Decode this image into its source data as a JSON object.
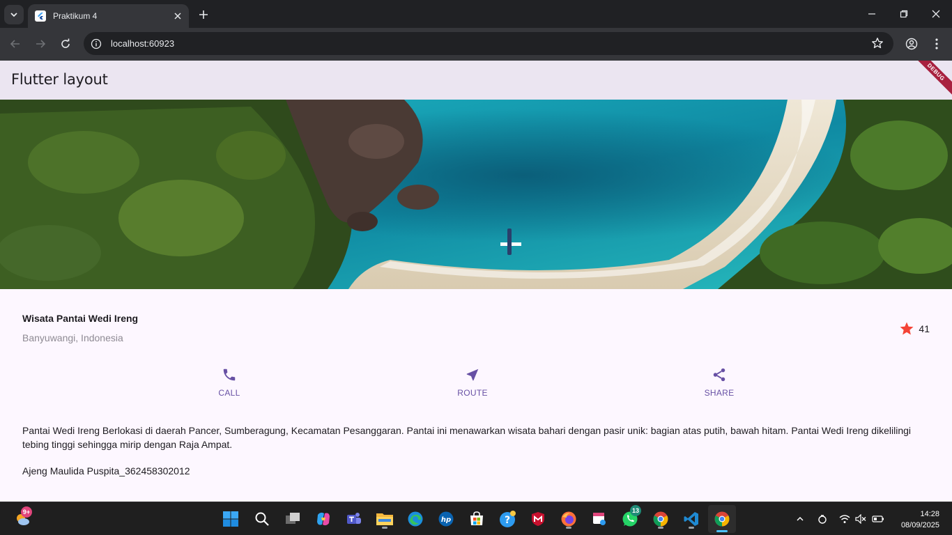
{
  "browser": {
    "tab_title": "Praktikum 4",
    "url": "localhost:60923"
  },
  "app": {
    "appbar_title": "Flutter layout",
    "debug_banner": "DEBUG",
    "place": {
      "name": "Wisata Pantai Wedi Ireng",
      "location": "Banyuwangi, Indonesia",
      "rating_count": "41"
    },
    "actions": [
      {
        "label": "CALL",
        "icon": "phone-icon"
      },
      {
        "label": "ROUTE",
        "icon": "near-me-icon"
      },
      {
        "label": "SHARE",
        "icon": "share-icon"
      }
    ],
    "description": "Pantai Wedi Ireng Berlokasi di daerah Pancer, Sumberagung, Kecamatan Pesanggaran. Pantai ini menawarkan wisata bahari dengan pasir unik: bagian atas putih, bawah hitam. Pantai Wedi Ireng dikelilingi tebing tinggi sehingga mirip dengan Raja Ampat.",
    "author": "Ajeng Maulida Puspita_362458302012"
  },
  "taskbar": {
    "weather_badge": "9+",
    "whatsapp_badge": "13",
    "time": "14:28",
    "date": "08/09/2025"
  },
  "colors": {
    "primary": "#6750a4",
    "star": "#f44336",
    "appbar": "#ebe5f1",
    "surface": "#fdf7ff"
  }
}
